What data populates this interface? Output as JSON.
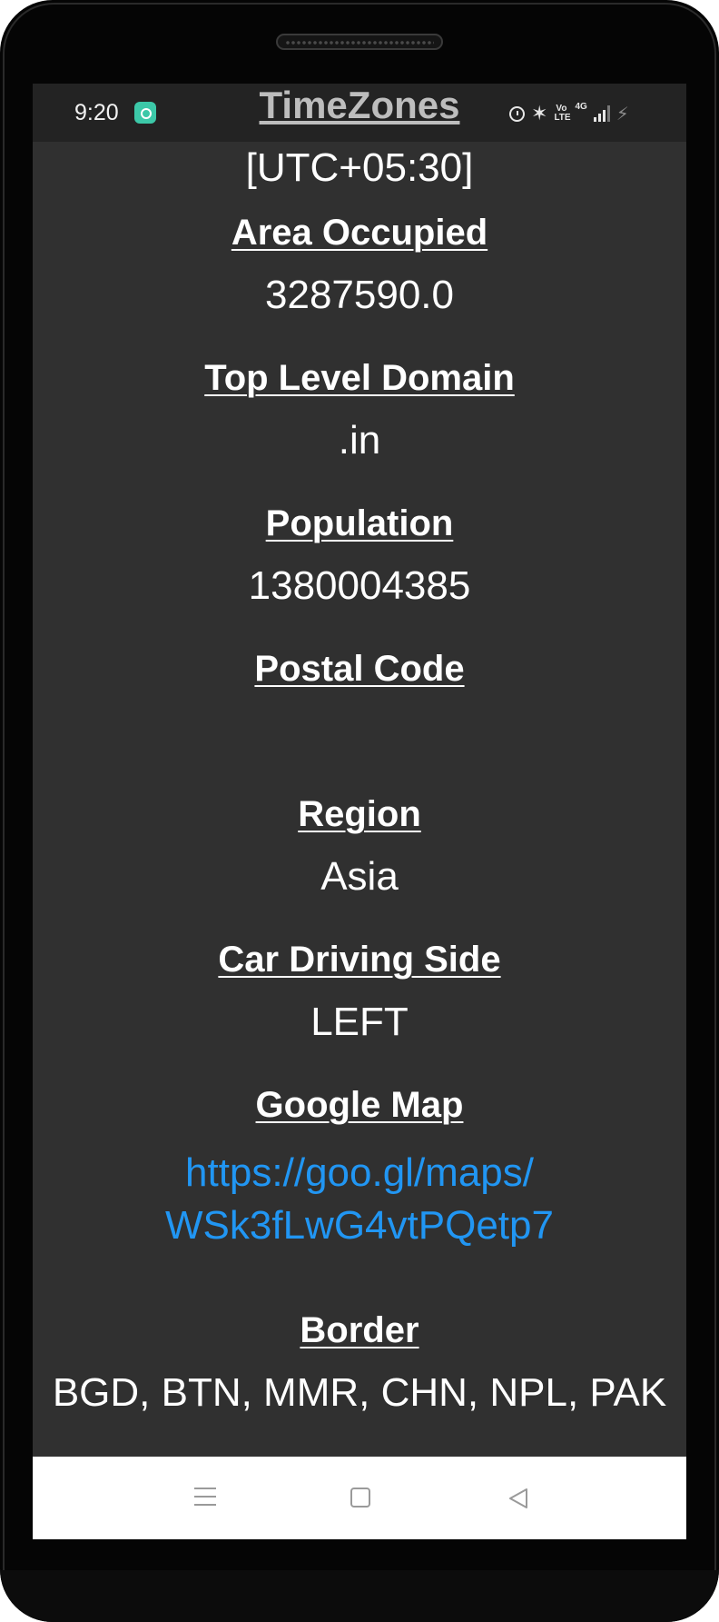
{
  "status_bar": {
    "time": "9:20",
    "icons": [
      "chat-app-icon",
      "alarm-icon",
      "bluetooth-icon",
      "volte-icon",
      "4g-signal-icon",
      "charging-icon"
    ],
    "volte_label": "Vo LTE",
    "network_label": "4G"
  },
  "app": {
    "title": "TimeZones"
  },
  "details": {
    "timezone_value": "[UTC+05:30]",
    "area_label": "Area Occupied",
    "area_value": "3287590.0",
    "tld_label": "Top Level Domain",
    "tld_value": ".in",
    "population_label": "Population",
    "population_value": "1380004385",
    "postal_label": "Postal Code",
    "postal_value": "",
    "region_label": "Region",
    "region_value": "Asia",
    "driving_label": "Car Driving Side",
    "driving_value": "LEFT",
    "map_label": "Google Map",
    "map_link_line1": "https://goo.gl/maps/",
    "map_link_line2": "WSk3fLwG4vtPQetp7",
    "border_label": "Border",
    "border_value": "BGD, BTN, MMR, CHN, NPL, PAK"
  },
  "nav_bar": {
    "buttons": [
      "menu-icon",
      "home-icon",
      "back-icon"
    ]
  },
  "colors": {
    "screen_bg": "#303030",
    "status_bg": "#232323",
    "link": "#2196f3",
    "text": "#ffffff",
    "nav_bg": "#ffffff"
  }
}
